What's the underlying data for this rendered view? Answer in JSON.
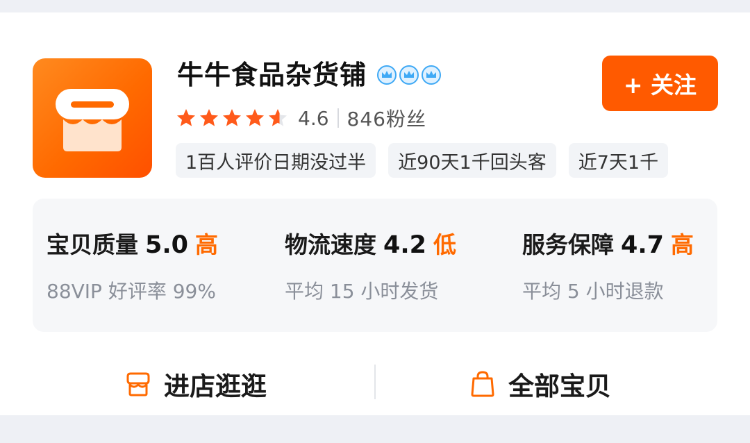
{
  "shop": {
    "name": "牛牛食品杂货铺",
    "crown_count": 3,
    "follow_label": "+ 关注",
    "rating": "4.6",
    "rating_stars_fraction": 0.92,
    "fans": "846粉丝"
  },
  "tags": [
    "1百人评价日期没过半",
    "近90天1千回头客",
    "近7天1千"
  ],
  "metrics": [
    {
      "label": "宝贝质量",
      "value": "5.0",
      "level": "高",
      "sub": "88VIP 好评率 99%"
    },
    {
      "label": "物流速度",
      "value": "4.2",
      "level": "低",
      "sub": "平均 15 小时发货"
    },
    {
      "label": "服务保障",
      "value": "4.7",
      "level": "高",
      "sub": "平均 5 小时退款"
    }
  ],
  "bottom": {
    "enter_store": "进店逛逛",
    "all_items": "全部宝贝"
  },
  "colors": {
    "accent": "#ff5a00",
    "star": "#ff5a1a",
    "level": "#ff6a00",
    "crown": "#3fa9f5"
  },
  "icons": [
    "store-logo-icon",
    "crown-icon",
    "star-icon",
    "store-icon",
    "shopping-bag-icon"
  ]
}
